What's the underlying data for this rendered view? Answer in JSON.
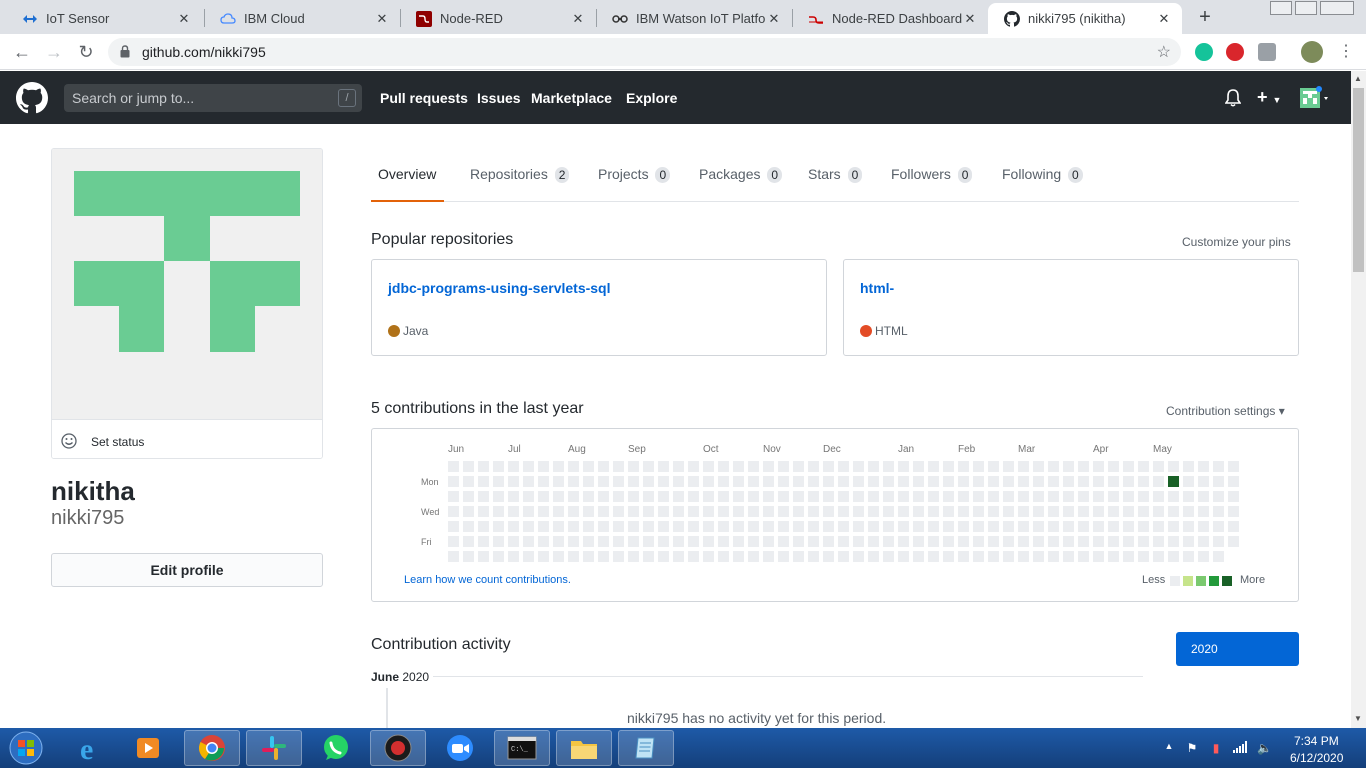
{
  "browser": {
    "tabs": [
      {
        "label": "IoT Sensor",
        "icon": "node-red-blue-icon"
      },
      {
        "label": "IBM Cloud",
        "icon": "ibm-cloud-icon"
      },
      {
        "label": "Node-RED",
        "icon": "node-red-icon"
      },
      {
        "label": "IBM Watson IoT Platform",
        "icon": "watson-iot-icon"
      },
      {
        "label": "Node-RED Dashboard",
        "icon": "node-red-dashboard-icon"
      },
      {
        "label": "nikki795 (nikitha)",
        "icon": "github-icon",
        "active": true
      }
    ],
    "new_tab": "+",
    "url": "github.com/nikki795"
  },
  "github_header": {
    "search_placeholder": "Search or jump to...",
    "search_shortcut": "/",
    "nav": [
      "Pull requests",
      "Issues",
      "Marketplace",
      "Explore"
    ]
  },
  "profile": {
    "set_status": "Set status",
    "full_name": "nikitha",
    "username": "nikki795",
    "edit_profile": "Edit profile"
  },
  "profile_tabs": [
    {
      "label": "Overview",
      "count": null,
      "selected": true
    },
    {
      "label": "Repositories",
      "count": "2"
    },
    {
      "label": "Projects",
      "count": "0"
    },
    {
      "label": "Packages",
      "count": "0"
    },
    {
      "label": "Stars",
      "count": "0"
    },
    {
      "label": "Followers",
      "count": "0"
    },
    {
      "label": "Following",
      "count": "0"
    }
  ],
  "popular": {
    "title": "Popular repositories",
    "customize": "Customize your pins",
    "repos": [
      {
        "name": "jdbc-programs-using-servlets-sql",
        "language": "Java",
        "lang_color": "#b07219"
      },
      {
        "name": "html-",
        "language": "HTML",
        "lang_color": "#e34c26"
      }
    ]
  },
  "contributions": {
    "title": "5 contributions in the last year",
    "settings": "Contribution settings ▾",
    "months": [
      "Jun",
      "Jul",
      "Aug",
      "Sep",
      "Oct",
      "Nov",
      "Dec",
      "Jan",
      "Feb",
      "Mar",
      "Apr",
      "May"
    ],
    "days": [
      "Mon",
      "Wed",
      "Fri"
    ],
    "learn_link": "Learn how we count contributions.",
    "less": "Less",
    "more": "More",
    "legend_colors": [
      "#ebedf0",
      "#c6e48b",
      "#7bc96f",
      "#239a3b",
      "#196127"
    ],
    "weeks": 53,
    "last_week_days": 6,
    "active_cells": [
      {
        "week": 48,
        "day": 1,
        "level": 4
      }
    ]
  },
  "activity": {
    "title": "Contribution activity",
    "year_button": "2020",
    "month_bold": "June",
    "month_year": " 2020",
    "empty_message": "nikki795 has no activity yet for this period."
  },
  "taskbar": {
    "apps": [
      "internet-explorer",
      "media-player",
      "chrome",
      "slack",
      "whatsapp",
      "obs",
      "zoom",
      "cmd",
      "file-explorer",
      "notepad"
    ],
    "time": "7:34 PM",
    "date": "6/12/2020"
  },
  "colors": {
    "github_dark": "#24292e",
    "link_blue": "#0366d6",
    "identicon_green": "#6acc93",
    "tab_underline": "#e36209"
  }
}
